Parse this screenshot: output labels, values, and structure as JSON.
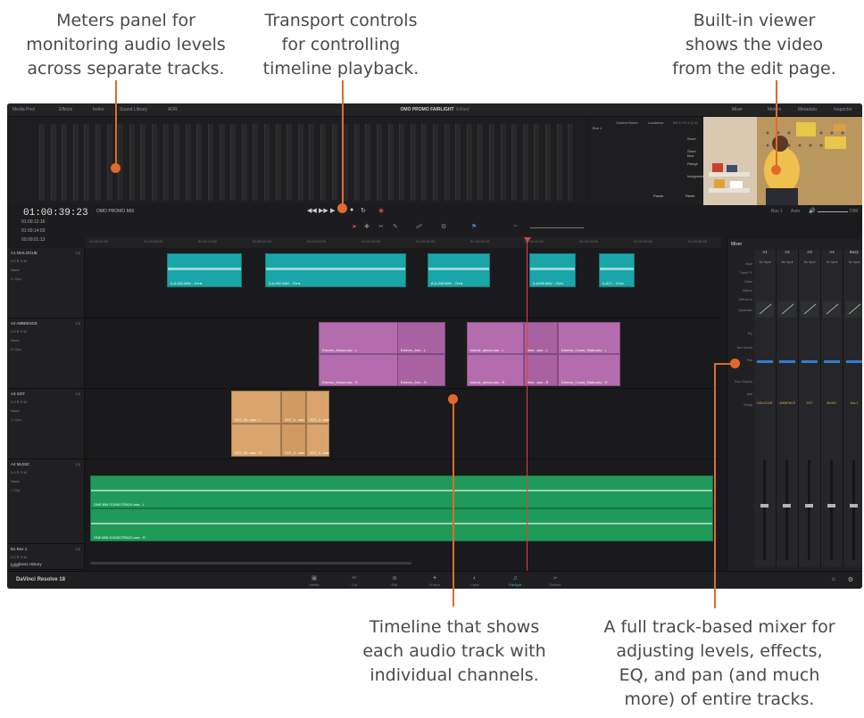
{
  "callouts": {
    "meters": [
      "Meters panel for",
      "monitoring audio levels",
      "across separate tracks."
    ],
    "transport": [
      "Transport controls",
      "for controlling",
      "timeline playback."
    ],
    "viewer": [
      "Built-in viewer",
      "shows the video",
      "from the edit page."
    ],
    "timeline": [
      "Timeline that shows",
      "each audio track with",
      "individual channels."
    ],
    "mixer": [
      "A full track-based mixer for",
      "adjusting levels, effects,",
      "EQ, and pan (and much",
      "more) of entire tracks."
    ]
  },
  "app": {
    "top_bar": {
      "left_items": [
        "Media Pool",
        "Effects",
        "Index",
        "Sound Library",
        "ADR"
      ],
      "project_title": "OMO PROMO FAIRLIGHT",
      "project_status": "Edited",
      "right_items": [
        "Mixer",
        "Meters",
        "Metadata",
        "Inspector"
      ]
    },
    "control_room": {
      "bus": "Bus 1",
      "tabs": [
        "Control Room",
        "Loudness"
      ],
      "standard": "BS.1770-1 (LU)",
      "readouts": [
        "Short",
        "Short Max",
        "Range",
        "Integrated"
      ],
      "buttons": [
        "Pause",
        "Reset"
      ]
    },
    "timeline_header": {
      "timecode": "01:00:39:23",
      "timeline_name": "OMO PROMO MIX",
      "info_rows": [
        "01:00:12:16",
        "01:00:14:03",
        "00:00:01:13"
      ],
      "bus_label": "Bus 1",
      "auto_label": "Auto",
      "dim_label": "DIM"
    },
    "ruler_ticks": [
      "01:00:00:00",
      "01:00:05:00",
      "01:00:10:00",
      "01:00:15:00",
      "01:00:20:00",
      "01:00:25:00",
      "01:00:30:00",
      "01:00:35:00",
      "01:00:40:00",
      "01:00:45:00",
      "01:00:50:00",
      "01:00:55:00"
    ],
    "tracks": [
      {
        "id": "A1",
        "name": "DIALOGUE",
        "level": "2.0",
        "value": "0.0",
        "mode": "None",
        "clips_label": "5 Clips",
        "color": "#1aa6a8"
      },
      {
        "id": "A2",
        "name": "AMBIENCE",
        "level": "2.0",
        "value": "0.0",
        "mode": "None",
        "clips_label": "5 Clips",
        "color": "#b46cae"
      },
      {
        "id": "A3",
        "name": "SOT",
        "level": "2.0",
        "value": "0.0",
        "mode": "None",
        "clips_label": "3 Clips",
        "color": "#d9a56c"
      },
      {
        "id": "A4",
        "name": "MUSIC",
        "level": "2.0",
        "value": "0.0",
        "mode": "None",
        "clips_label": "1 Clip",
        "color": "#1f9a58"
      },
      {
        "id": "B1",
        "name": "Bus 1",
        "level": "2.0",
        "value": "0.0",
        "mode": "None",
        "clips_label": "",
        "color": "#555555"
      }
    ],
    "clips": {
      "dialogue": [
        "A-A-002.WAV - Chris",
        "A-A-002.WAV - Chris",
        "A-A-008.WAV - Chris",
        "A-A008.WAV - Chris",
        "A-A17... Chris"
      ],
      "ambience_top": [
        "Exterior_Atmos.wav - L",
        "Exterior_Atm... L",
        "Interior_atmos.wav - L",
        "Inter...wav - L",
        "Exterior_Crowd_Walla.wav - L"
      ],
      "ambience_bottom": [
        "Exterior_Atmos.wav - R",
        "Exterior_Atm... R",
        "Interior_atmos.wav - R",
        "Inter...wav - R",
        "Exterior_Crowd_Walla.wav - R"
      ],
      "sot_top": [
        "SOT_04...wav - L",
        "SOT_0...wav",
        "SOT_0...wav"
      ],
      "sot_bottom": [
        "SOT_04...wav - R",
        "SOT_0...wav",
        "SOT_0...wav"
      ],
      "music_top": "ONE MIN SOUNDTRACK.wav - L",
      "music_bottom": "ONE MIN SOUNDTRACK.wav - R"
    },
    "loudness_history": "Loudness History",
    "mixer": {
      "title": "Mixer",
      "channels": [
        "A1",
        "A2",
        "A3",
        "A4",
        "Bus1"
      ],
      "channel_names": [
        "DIALOGUE",
        "AMBIENCE",
        "SOT",
        "MUSIC",
        "Bus 1"
      ],
      "row_labels": [
        "Input",
        "Track FX",
        "Order",
        "Effects",
        "Effects In",
        "Dynamics",
        "EQ",
        "Bus Sends",
        "Pan",
        "Bus Outputs",
        "Add",
        "Group"
      ],
      "input_value": "No Input"
    },
    "bottom_bar": {
      "brand": "DaVinci Resolve 18",
      "pages": [
        "Media",
        "Cut",
        "Edit",
        "Fusion",
        "Color",
        "Fairlight",
        "Deliver"
      ],
      "active_page": "Fairlight"
    },
    "colors": {
      "accent": "#e06a2c",
      "playhead": "#d84444",
      "active_page": "#3fb8c8"
    }
  }
}
